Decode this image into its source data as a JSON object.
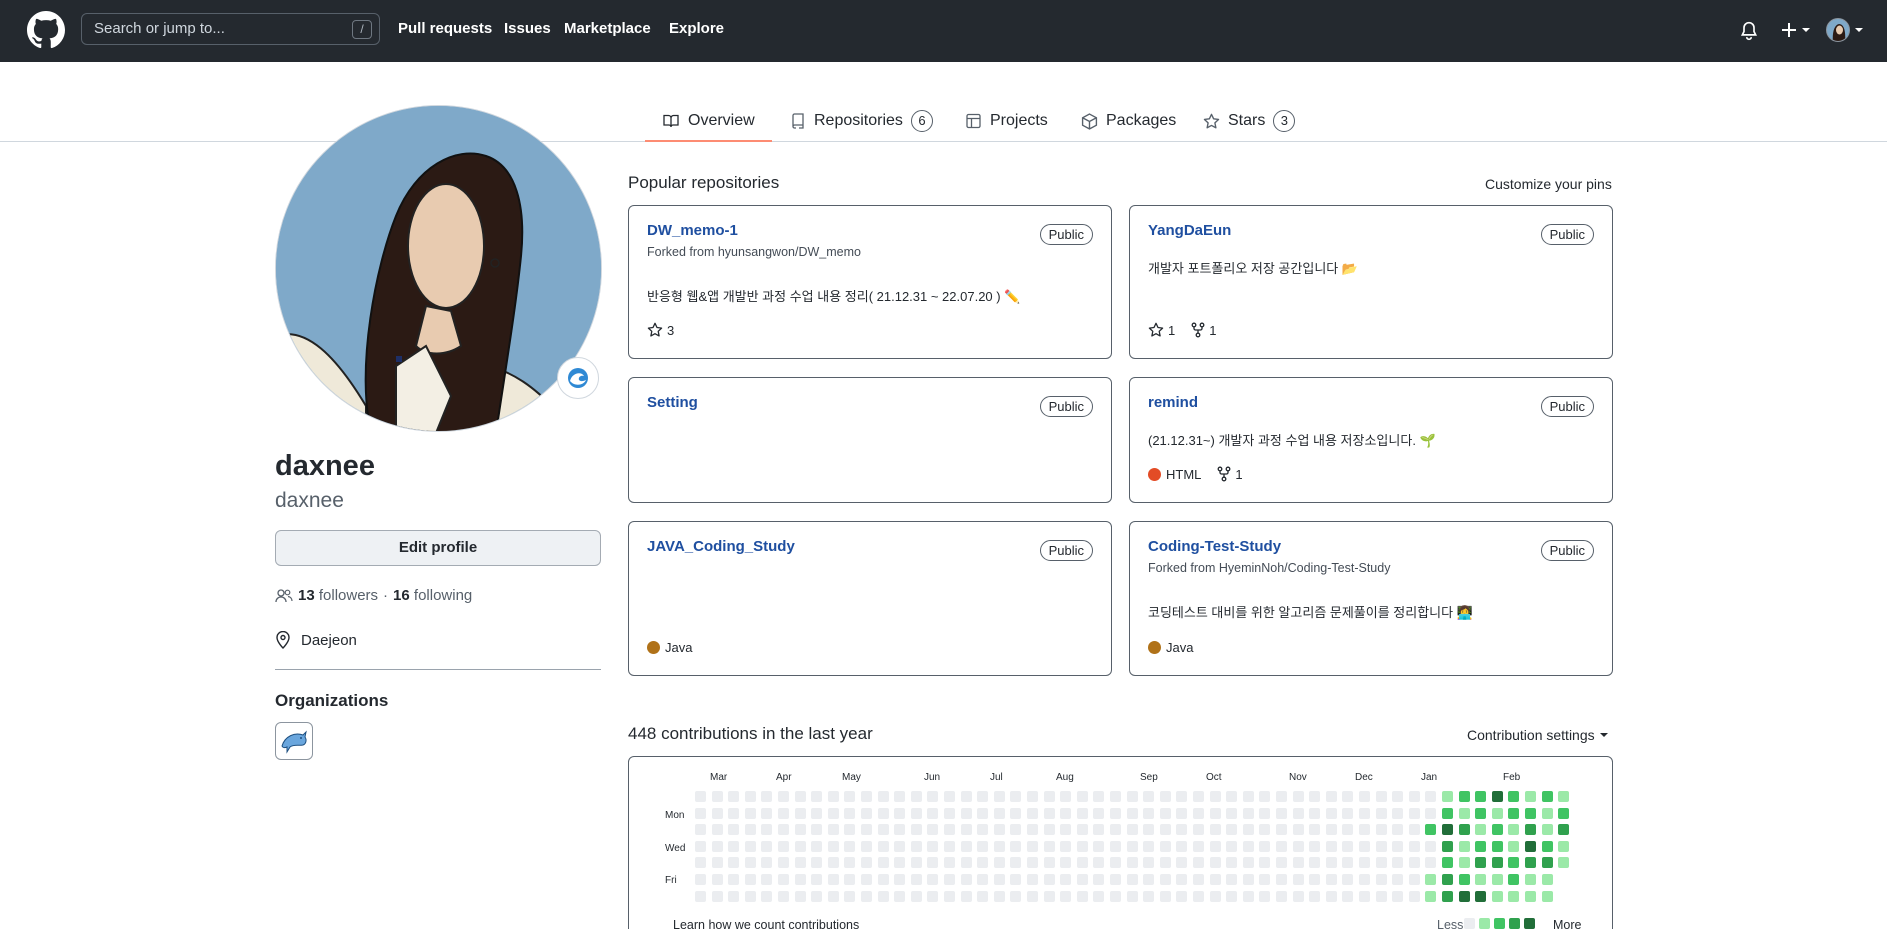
{
  "header": {
    "search_placeholder": "Search or jump to...",
    "search_shortcut": "/",
    "nav": [
      "Pull requests",
      "Issues",
      "Marketplace",
      "Explore"
    ]
  },
  "tabs": [
    {
      "label": "Overview",
      "count": ""
    },
    {
      "label": "Repositories",
      "count": "6"
    },
    {
      "label": "Projects",
      "count": ""
    },
    {
      "label": "Packages",
      "count": ""
    },
    {
      "label": "Stars",
      "count": "3"
    }
  ],
  "profile": {
    "name": "daxnee",
    "login": "daxnee",
    "edit_label": "Edit profile",
    "followers": "13",
    "followers_label": "followers",
    "separator": "·",
    "following": "16",
    "following_label": "following",
    "location": "Daejeon",
    "orgs_title": "Organizations"
  },
  "pinned": {
    "title": "Popular repositories",
    "customize": "Customize your pins",
    "repos": [
      {
        "name": "DW_memo-1",
        "badge": "Public",
        "fork": "Forked from hyunsangwon/DW_memo",
        "desc": "반응형 웹&앱 개발반 과정 수업 내용 정리( 21.12.31 ~ 22.07.20 ) ✏️",
        "lang": "",
        "stars": "3",
        "forks": ""
      },
      {
        "name": "YangDaEun",
        "badge": "Public",
        "fork": "",
        "desc": "개발자 포트폴리오 저장 공간입니다 📂",
        "lang": "",
        "stars": "1",
        "forks": "1"
      },
      {
        "name": "Setting",
        "badge": "Public",
        "fork": "",
        "desc": "",
        "lang": "",
        "stars": "",
        "forks": ""
      },
      {
        "name": "remind",
        "badge": "Public",
        "fork": "",
        "desc": "(21.12.31~) 개발자 과정 수업 내용 저장소입니다. 🌱",
        "lang": "HTML",
        "stars": "",
        "forks": "1"
      },
      {
        "name": "JAVA_Coding_Study",
        "badge": "Public",
        "fork": "",
        "desc": "",
        "lang": "Java",
        "stars": "",
        "forks": ""
      },
      {
        "name": "Coding-Test-Study",
        "badge": "Public",
        "fork": "Forked from HyeminNoh/Coding-Test-Study",
        "desc": "코딩테스트 대비를 위한 알고리즘 문제풀이를 정리합니다 👩‍💻",
        "lang": "Java",
        "stars": "",
        "forks": ""
      }
    ]
  },
  "contributions": {
    "title": "448 contributions in the last year",
    "settings": "Contribution settings",
    "months": [
      "Mar",
      "Apr",
      "May",
      "Jun",
      "Jul",
      "Aug",
      "Sep",
      "Oct",
      "Nov",
      "Dec",
      "Jan",
      "Feb"
    ],
    "days": [
      "Mon",
      "Wed",
      "Fri"
    ],
    "learn": "Learn how we count contributions",
    "less": "Less",
    "more": "More"
  },
  "colors": {
    "html": "#e34c26",
    "java": "#b07219",
    "level0": "#ebedf0",
    "level1": "#9be9a8",
    "level2": "#40c463",
    "level3": "#30a14e",
    "level4": "#216e39"
  }
}
